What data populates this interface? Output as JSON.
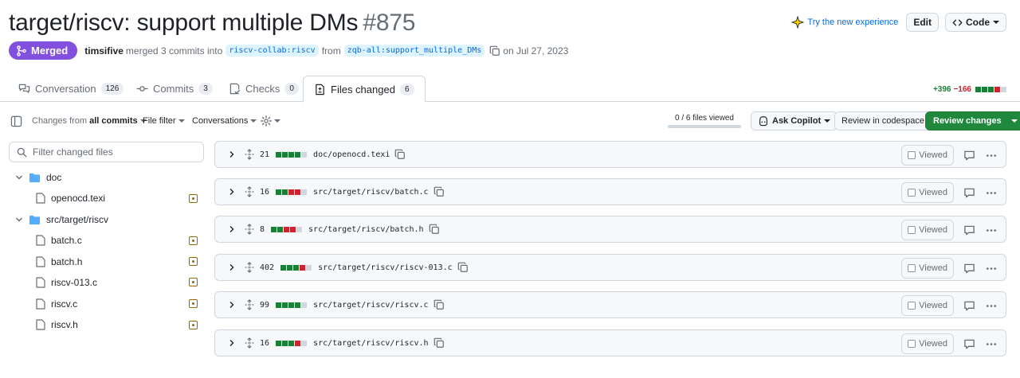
{
  "header": {
    "title": "target/riscv: support multiple DMs",
    "number": "#875",
    "try_new": "Try the new experience",
    "edit_label": "Edit",
    "code_label": "Code"
  },
  "meta": {
    "status": "Merged",
    "author": "timsifive",
    "merged_text": "merged 3 commits into",
    "base_branch": "riscv-collab:riscv",
    "from_text": "from",
    "head_branch": "zqb-all:support_multiple_DMs",
    "date_text": "on Jul 27, 2023"
  },
  "tabs": [
    {
      "label": "Conversation",
      "count": "126"
    },
    {
      "label": "Commits",
      "count": "3"
    },
    {
      "label": "Checks",
      "count": "0"
    },
    {
      "label": "Files changed",
      "count": "6"
    }
  ],
  "diffstat": {
    "additions": "+396",
    "deletions": "−166"
  },
  "toolbar": {
    "changes_from": "Changes from",
    "all_commits": "all commits",
    "file_filter": "File filter",
    "conversations": "Conversations",
    "files_viewed": "0 / 6 files viewed",
    "ask_copilot": "Ask Copilot",
    "review_codespace": "Review in codespace",
    "review_changes": "Review changes"
  },
  "sidebar": {
    "filter_placeholder": "Filter changed files",
    "tree": [
      {
        "type": "folder",
        "name": "doc"
      },
      {
        "type": "file",
        "name": "openocd.texi"
      },
      {
        "type": "folder",
        "name": "src/target/riscv"
      },
      {
        "type": "file",
        "name": "batch.c"
      },
      {
        "type": "file",
        "name": "batch.h"
      },
      {
        "type": "file",
        "name": "riscv-013.c"
      },
      {
        "type": "file",
        "name": "riscv.c"
      },
      {
        "type": "file",
        "name": "riscv.h"
      }
    ]
  },
  "files": [
    {
      "changes": "21",
      "path": "doc/openocd.texi",
      "blocks": [
        "g",
        "g",
        "g",
        "g",
        "n"
      ],
      "viewed_label": "Viewed"
    },
    {
      "changes": "16",
      "path": "src/target/riscv/batch.c",
      "blocks": [
        "g",
        "g",
        "r",
        "r",
        "n"
      ],
      "viewed_label": "Viewed"
    },
    {
      "changes": "8",
      "path": "src/target/riscv/batch.h",
      "blocks": [
        "g",
        "g",
        "r",
        "r",
        "n"
      ],
      "viewed_label": "Viewed"
    },
    {
      "changes": "402",
      "path": "src/target/riscv/riscv-013.c",
      "blocks": [
        "g",
        "g",
        "g",
        "r",
        "n"
      ],
      "viewed_label": "Viewed"
    },
    {
      "changes": "99",
      "path": "src/target/riscv/riscv.c",
      "blocks": [
        "g",
        "g",
        "g",
        "g",
        "n"
      ],
      "viewed_label": "Viewed"
    },
    {
      "changes": "16",
      "path": "src/target/riscv/riscv.h",
      "blocks": [
        "g",
        "g",
        "g",
        "r",
        "n"
      ],
      "viewed_label": "Viewed"
    }
  ],
  "colors": {
    "merged": "#8250df",
    "addition": "#1a7f37",
    "deletion": "#cf222e",
    "neutral": "#d0d7de",
    "link": "#0969da",
    "primary_button": "#1f883d"
  }
}
